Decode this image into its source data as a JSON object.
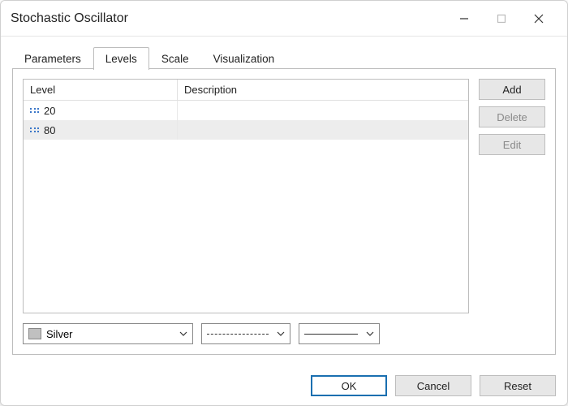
{
  "window": {
    "title": "Stochastic Oscillator"
  },
  "tabs": {
    "parameters": "Parameters",
    "levels": "Levels",
    "scale": "Scale",
    "visualization": "Visualization"
  },
  "table": {
    "headers": {
      "level": "Level",
      "description": "Description"
    },
    "rows": [
      {
        "level": "20",
        "description": ""
      },
      {
        "level": "80",
        "description": ""
      }
    ]
  },
  "side_buttons": {
    "add": "Add",
    "delete": "Delete",
    "edit": "Edit"
  },
  "style_controls": {
    "color_name": "Silver",
    "color_hex": "#c0c0c0"
  },
  "footer": {
    "ok": "OK",
    "cancel": "Cancel",
    "reset": "Reset"
  }
}
